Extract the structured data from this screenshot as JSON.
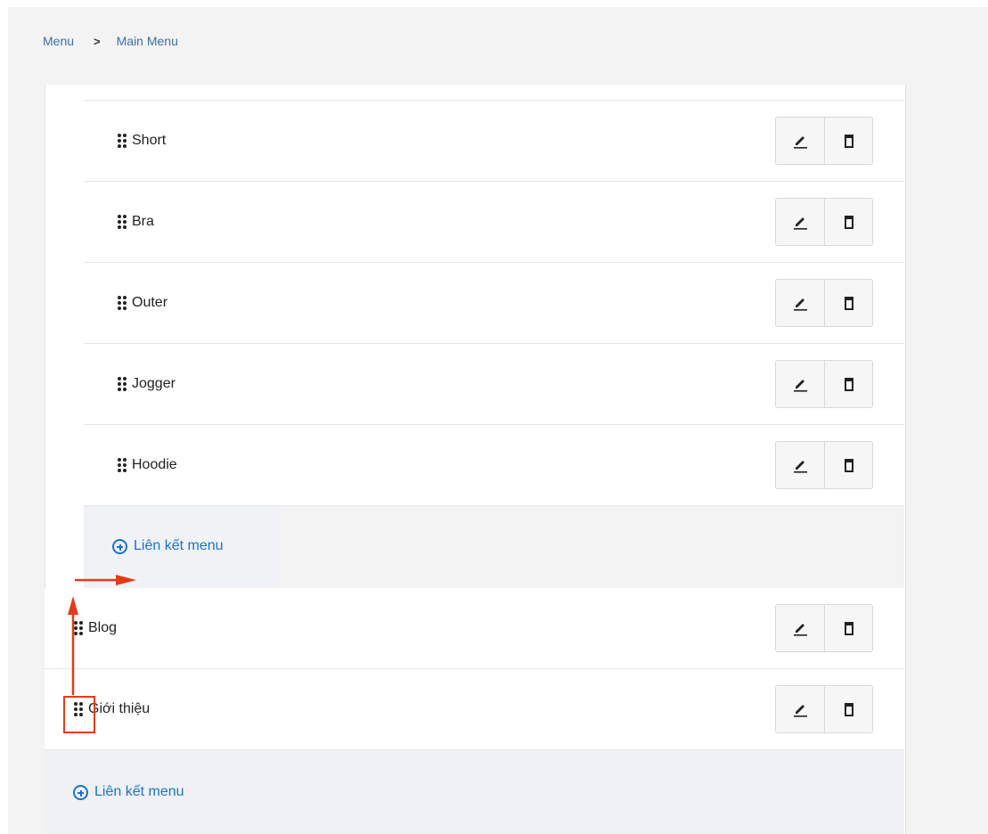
{
  "breadcrumb": {
    "items": [
      "Menu",
      "Main Menu"
    ],
    "separator": ">"
  },
  "child_items": [
    {
      "label": "Short"
    },
    {
      "label": "Bra"
    },
    {
      "label": "Outer"
    },
    {
      "label": "Jogger"
    },
    {
      "label": "Hoodie"
    }
  ],
  "child_add_link": "Liên kết menu",
  "parent_items": [
    {
      "label": "Blog"
    },
    {
      "label": "Giới thiệu"
    }
  ],
  "parent_add_link": "Liên kết menu",
  "icons": {
    "drag": "drag-handle-icon",
    "edit": "pencil-icon",
    "delete": "trash-icon",
    "add": "plus-circle-icon"
  },
  "colors": {
    "link": "#1a73c9",
    "annotation": "#e23b1a"
  }
}
